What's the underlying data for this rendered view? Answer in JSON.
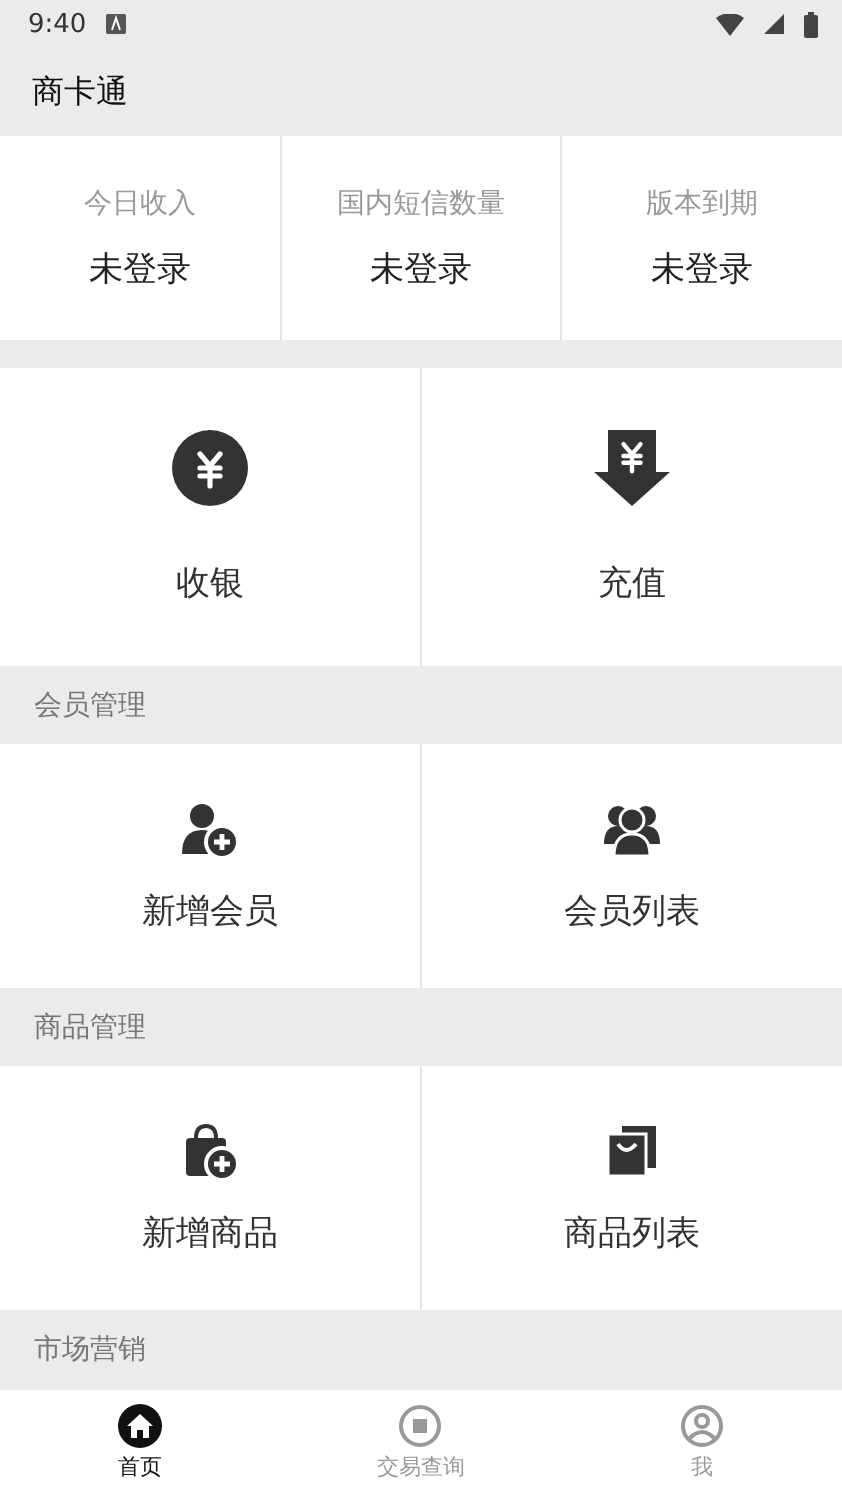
{
  "status_bar": {
    "time": "9:40"
  },
  "app_bar": {
    "title": "商卡通"
  },
  "stats": [
    {
      "label": "今日收入",
      "value": "未登录"
    },
    {
      "label": "国内短信数量",
      "value": "未登录"
    },
    {
      "label": "版本到期",
      "value": "未登录"
    }
  ],
  "main_actions": [
    {
      "label": "收银",
      "kind": "cashier"
    },
    {
      "label": "充值",
      "kind": "recharge"
    }
  ],
  "sections": [
    {
      "title": "会员管理",
      "items": [
        {
          "label": "新增会员",
          "kind": "add-member"
        },
        {
          "label": "会员列表",
          "kind": "members"
        }
      ]
    },
    {
      "title": "商品管理",
      "items": [
        {
          "label": "新增商品",
          "kind": "add-goods"
        },
        {
          "label": "商品列表",
          "kind": "goods"
        }
      ]
    },
    {
      "title": "市场营销"
    }
  ],
  "tabs": [
    {
      "label": "首页",
      "kind": "home",
      "selected": true
    },
    {
      "label": "交易查询",
      "kind": "query",
      "selected": false
    },
    {
      "label": "我",
      "kind": "me",
      "selected": false
    }
  ]
}
